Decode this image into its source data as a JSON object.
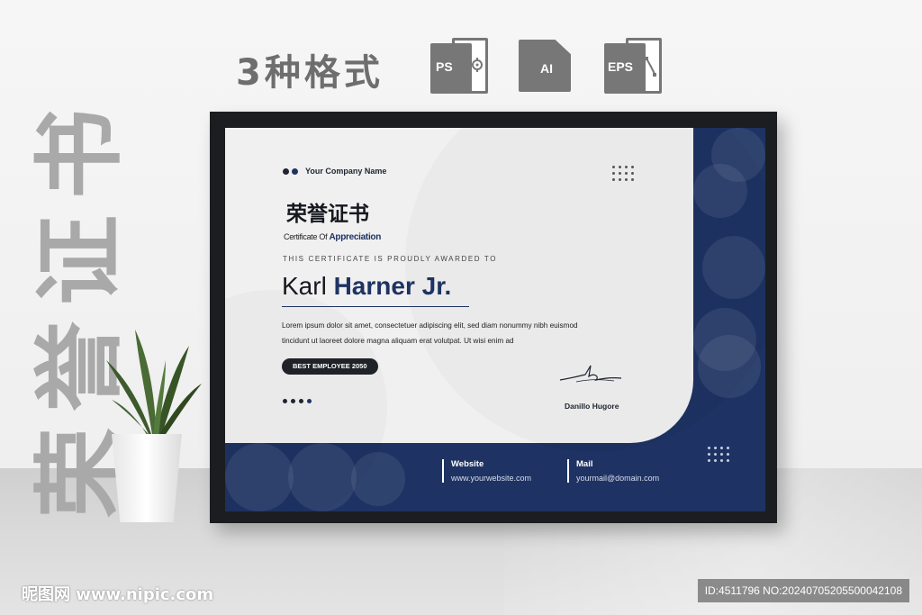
{
  "side_title": [
    "书",
    "证",
    "誉",
    "荣"
  ],
  "formats": {
    "title": "3种格式",
    "items": [
      {
        "label": "PS",
        "icon": "ps-file-icon"
      },
      {
        "label": "AI",
        "icon": "ai-file-icon"
      },
      {
        "label": "EPS",
        "icon": "eps-file-icon"
      }
    ]
  },
  "certificate": {
    "company": "Your Company Name",
    "title_cn": "荣誉证书",
    "subtitle_prefix": "Certificate Of ",
    "subtitle_accent": "Appreciation",
    "awarded_line": "THIS CERTIFICATE IS PROUDLY AWARDED TO",
    "name_first": "Karl ",
    "name_last": "Harner Jr.",
    "body_line1": "Lorem ipsum dolor sit amet, consectetuer adipiscing elit, sed diam nonummy nibh euismod",
    "body_line2": "tincidunt ut laoreet dolore magna aliquam erat volutpat. Ut wisi enim ad",
    "badge": "BEST EMPLOYEE 2050",
    "signer": "Danillo Hugore",
    "footer": {
      "website_label": "Website",
      "website_value": "www.yourwebsite.com",
      "mail_label": "Mail",
      "mail_value": "yourmail@domain.com"
    },
    "colors": {
      "navy": "#1e3363",
      "panel": "#f0f0f0",
      "frame": "#1b1d20"
    }
  },
  "watermark": {
    "left": "昵图网 www.nipic.com",
    "right": "ID:4511796 NO:20240705205500042108"
  }
}
